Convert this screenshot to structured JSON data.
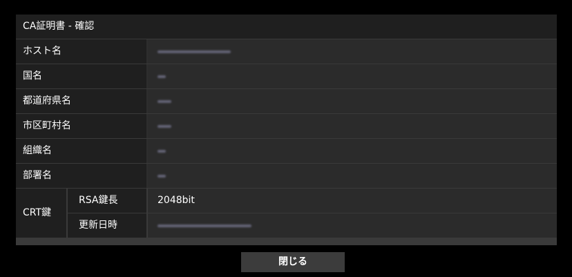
{
  "dialog": {
    "title": "CA証明書 - 確認",
    "close_label": "閉じる"
  },
  "fields": {
    "host_name_label": "ホスト名",
    "country_label": "国名",
    "state_label": "都道府県名",
    "city_label": "市区町村名",
    "organization_label": "組織名",
    "unit_label": "部署名"
  },
  "crt": {
    "label": "CRT鍵",
    "rsa_label": "RSA鍵長",
    "rsa_value": "2048bit",
    "updated_label": "更新日時"
  }
}
